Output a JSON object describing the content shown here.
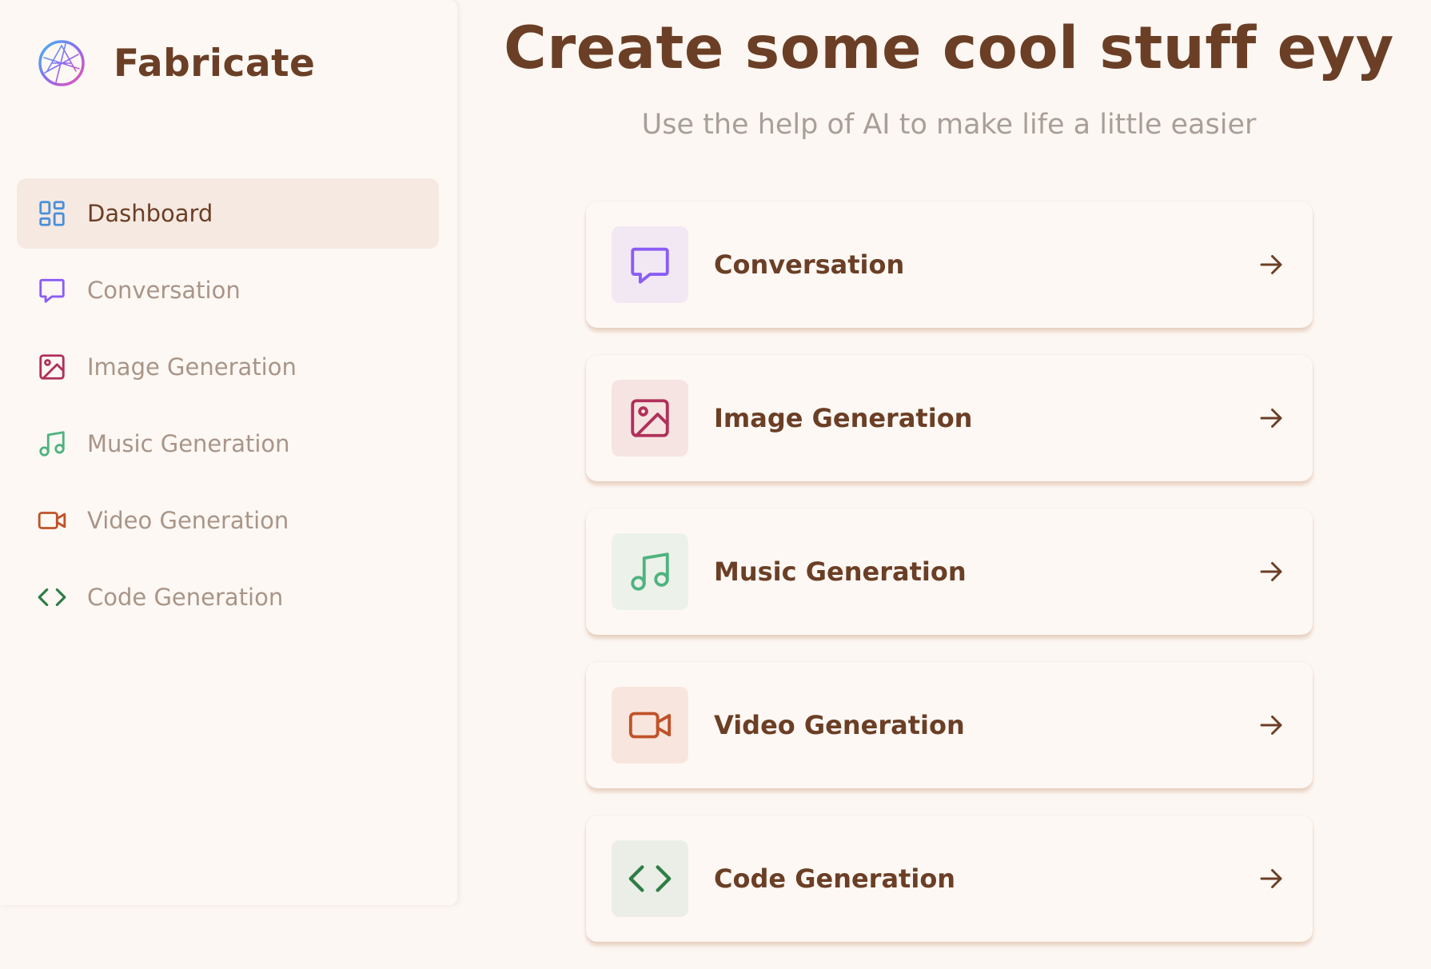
{
  "app": {
    "name": "Fabricate"
  },
  "sidebar": {
    "items": [
      {
        "label": "Dashboard",
        "icon": "dashboard-icon",
        "color": "#4a90d9",
        "active": true
      },
      {
        "label": "Conversation",
        "icon": "message-square-icon",
        "color": "#8b5cf6",
        "active": false
      },
      {
        "label": "Image Generation",
        "icon": "image-icon",
        "color": "#b0305a",
        "active": false
      },
      {
        "label": "Music Generation",
        "icon": "music-icon",
        "color": "#4fb37f",
        "active": false
      },
      {
        "label": "Video Generation",
        "icon": "video-icon",
        "color": "#c0522a",
        "active": false
      },
      {
        "label": "Code Generation",
        "icon": "code-icon",
        "color": "#2f7d46",
        "active": false
      }
    ]
  },
  "main": {
    "title": "Create some cool stuff eyy",
    "subtitle": "Use the help of AI to make life a little easier",
    "tools": [
      {
        "label": "Conversation",
        "icon": "message-square-icon",
        "color": "#8b5cf6",
        "background": "#f1e8f4"
      },
      {
        "label": "Image Generation",
        "icon": "image-icon",
        "color": "#b0305a",
        "background": "#f6e4e2"
      },
      {
        "label": "Music Generation",
        "icon": "music-icon",
        "color": "#4fb37f",
        "background": "#ecf1ea"
      },
      {
        "label": "Video Generation",
        "icon": "video-icon",
        "color": "#c0522a",
        "background": "#f8e6de"
      },
      {
        "label": "Code Generation",
        "icon": "code-icon",
        "color": "#2f7d46",
        "background": "#eaeee6"
      }
    ]
  },
  "colors": {
    "background": "#fdf7f3",
    "accent_text": "#6b3f26",
    "muted_text": "#a99588",
    "active_nav_bg": "#f6e9e1"
  }
}
